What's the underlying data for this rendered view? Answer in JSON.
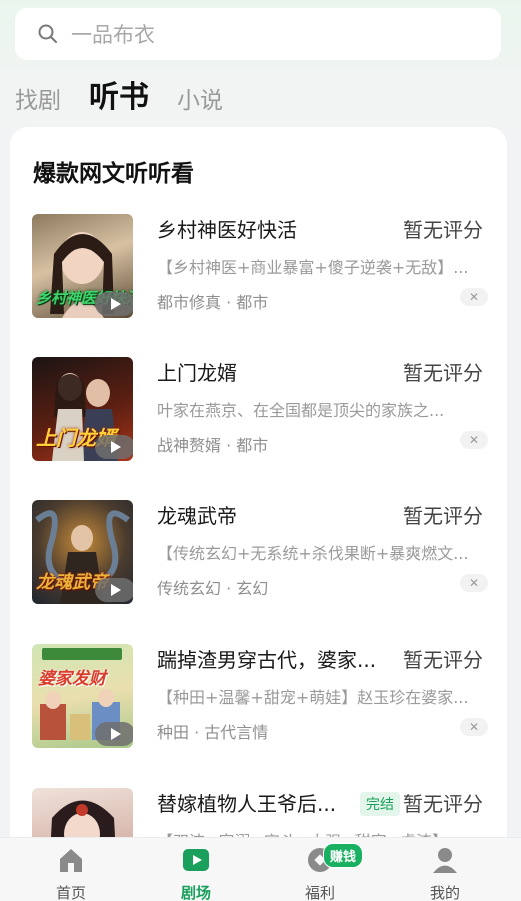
{
  "search": {
    "placeholder": "一品布衣",
    "icon": "search-icon"
  },
  "tabs": [
    {
      "label": "找剧",
      "active": false
    },
    {
      "label": "听书",
      "active": true
    },
    {
      "label": "小说",
      "active": false
    }
  ],
  "section": {
    "title": "爆款网文听听看"
  },
  "items": [
    {
      "title": "乡村神医好快活",
      "rating": "暂无评分",
      "badge": "",
      "desc": "【乡村神医+商业暴富+傻子逆袭+无敌】...",
      "tags": "都市修真 · 都市",
      "cover_text": "乡村神医好快活",
      "cover_colors": [
        "#6d5a3f",
        "#b08d63"
      ]
    },
    {
      "title": "上门龙婿",
      "rating": "暂无评分",
      "badge": "",
      "desc": "叶家在燕京、在全国都是顶尖的家族之...",
      "tags": "战神赘婿 · 都市",
      "cover_text": "上门龙婿",
      "cover_colors": [
        "#1c1a1a",
        "#8a2a14"
      ]
    },
    {
      "title": "龙魂武帝",
      "rating": "暂无评分",
      "badge": "",
      "desc": "【传统玄幻+无系统+杀伐果断+暴爽燃文...",
      "tags": "传统玄幻 · 玄幻",
      "cover_text": "龙魂武帝",
      "cover_colors": [
        "#2a3140",
        "#9a6b2a"
      ]
    },
    {
      "title": "踹掉渣男穿古代，婆家...",
      "rating": "暂无评分",
      "badge": "",
      "desc": "【种田+温馨+甜宠+萌娃】赵玉珍在婆家...",
      "tags": "种田 · 古代言情",
      "cover_text": "婆家发财",
      "cover_colors": [
        "#bcd99a",
        "#e8d9a0"
      ]
    },
    {
      "title": "替嫁植物人王爷后...",
      "rating": "暂无评分",
      "badge": "完结",
      "desc": "【双洁+宠溺+宫斗+大强+甜宠+虐渣】...",
      "tags": "",
      "cover_text": "",
      "cover_colors": [
        "#e8d4cc",
        "#b8433a"
      ]
    }
  ],
  "nav": [
    {
      "label": "首页",
      "icon": "home-icon",
      "active": false
    },
    {
      "label": "剧场",
      "icon": "theater-play-icon",
      "active": true
    },
    {
      "label": "福利",
      "icon": "coin-icon",
      "active": false,
      "badge": "赚钱"
    },
    {
      "label": "我的",
      "icon": "profile-icon",
      "active": false
    }
  ],
  "colors": {
    "accent": "#1aa05c",
    "background": "#f2f3f5"
  }
}
